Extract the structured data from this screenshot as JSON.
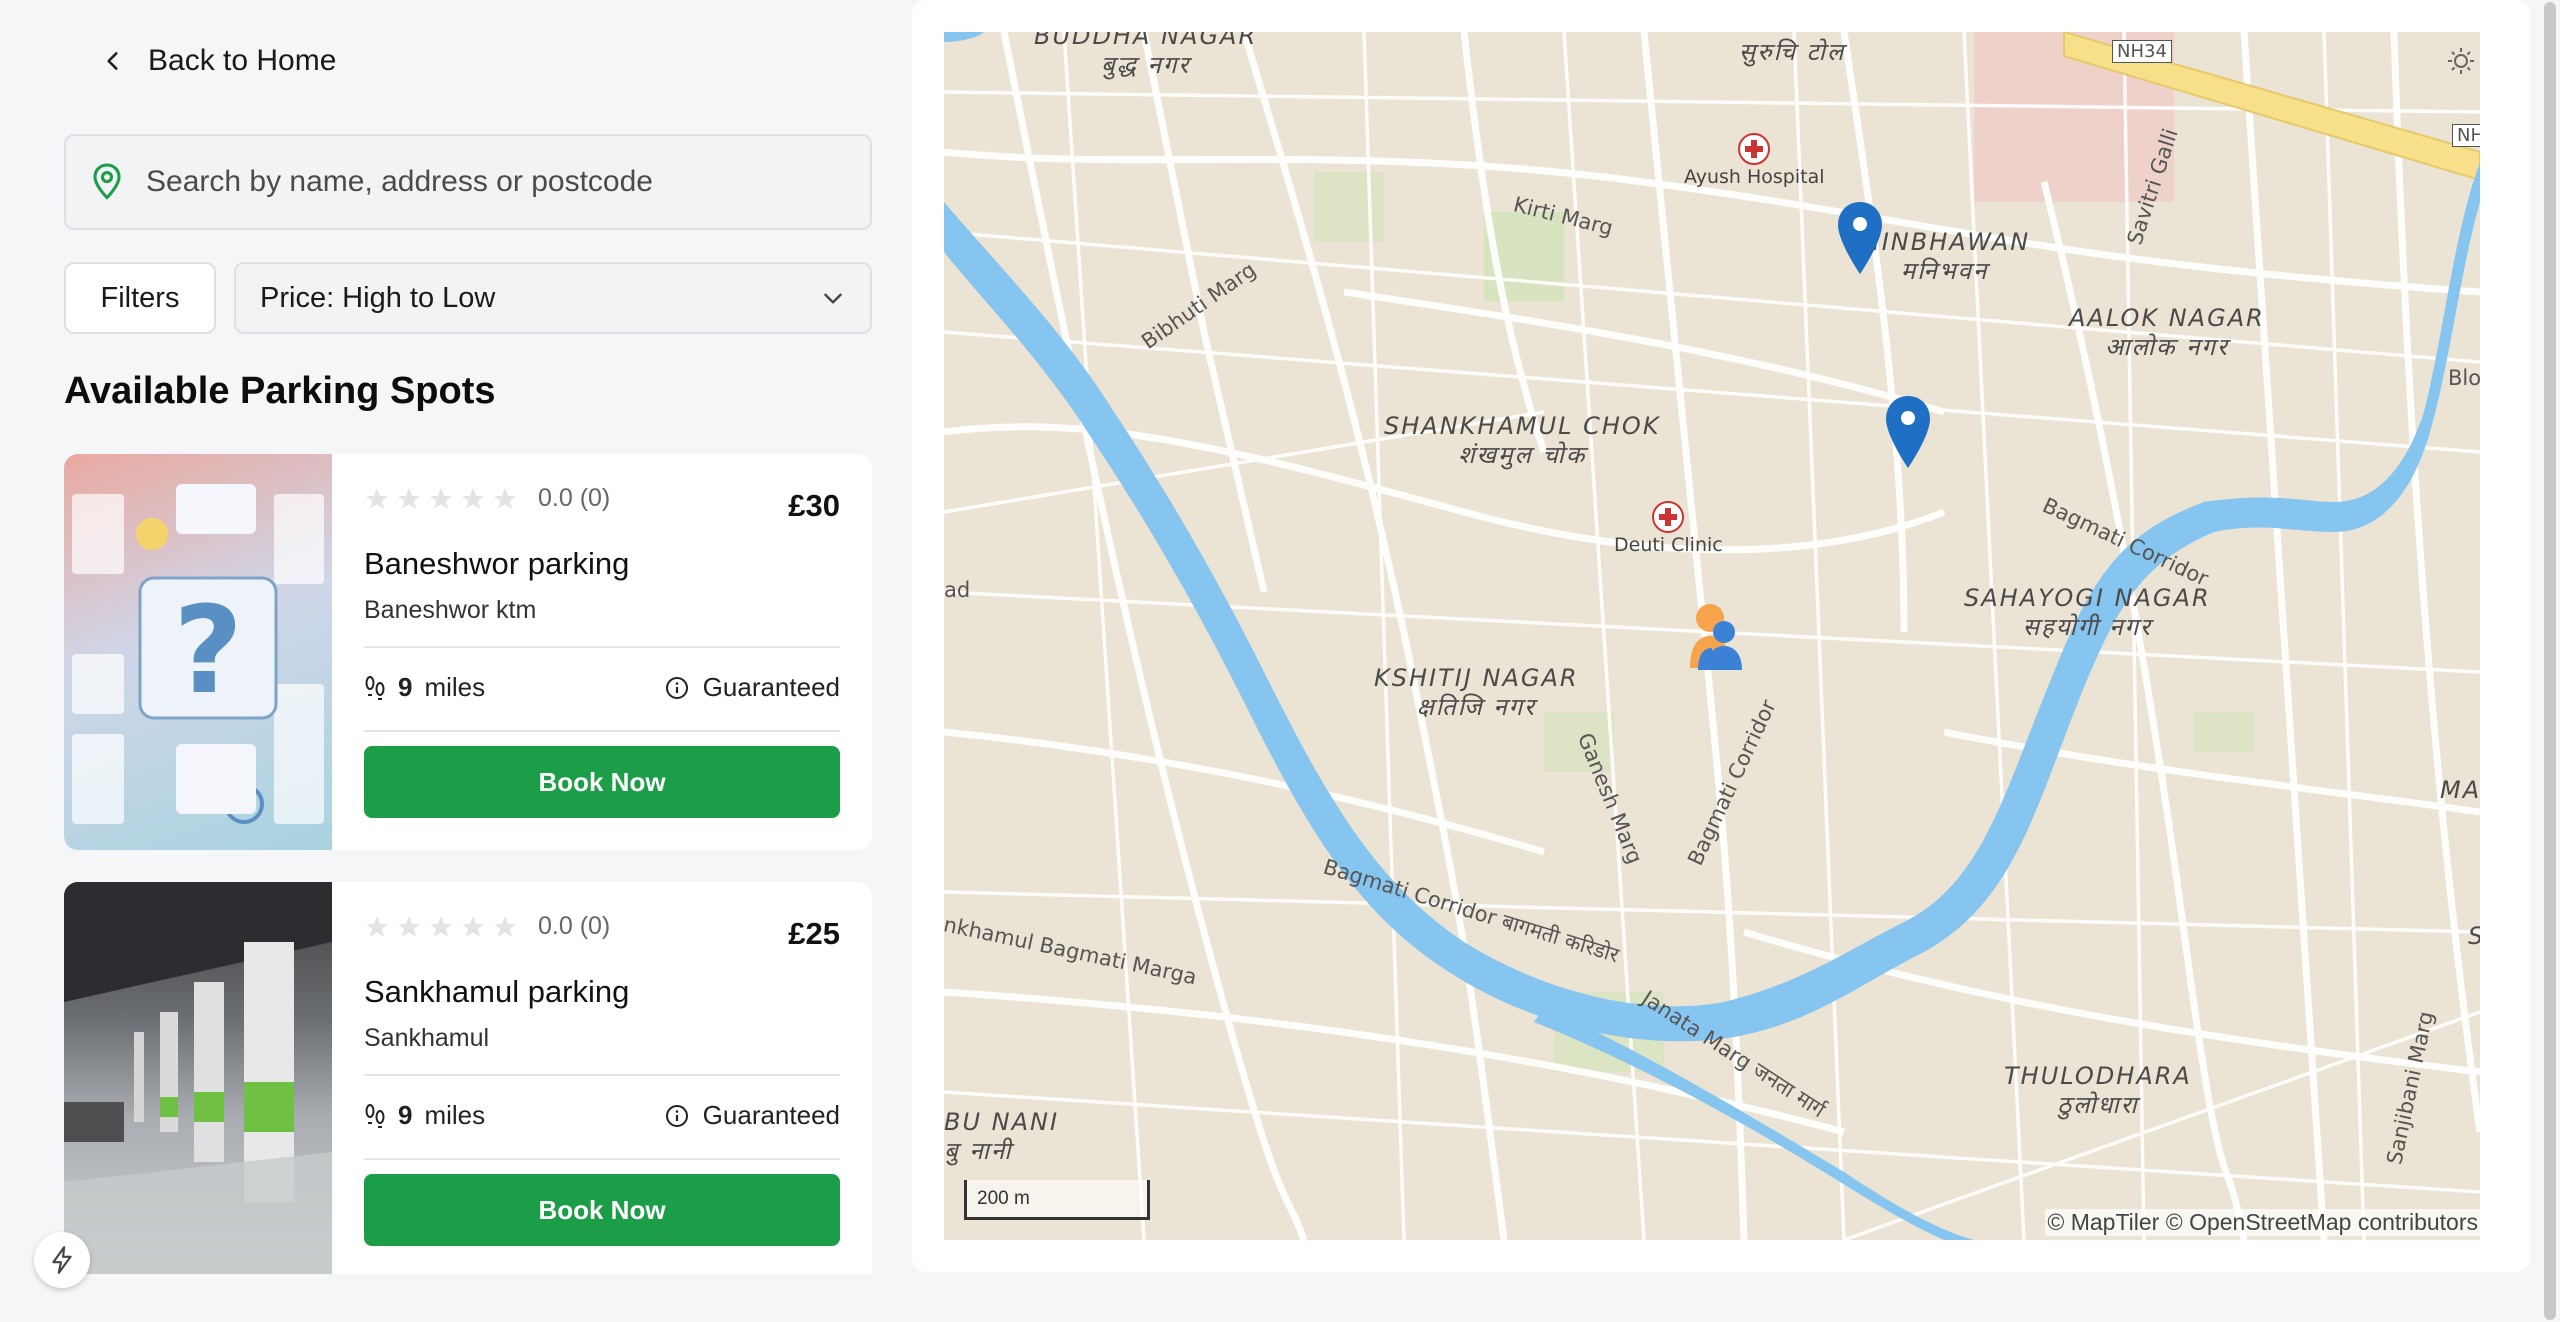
{
  "nav": {
    "back_label": "Back to Home"
  },
  "search": {
    "placeholder": "Search by name, address or postcode",
    "value": ""
  },
  "controls": {
    "filters_label": "Filters",
    "sort_value": "Price: High to Low"
  },
  "list": {
    "heading": "Available Parking Spots",
    "spots": [
      {
        "rating": "0.0 (0)",
        "price": "£30",
        "name": "Baneshwor parking",
        "address": "Baneshwor ktm",
        "distance_value": "9",
        "distance_unit": "miles",
        "guarantee": "Guaranteed",
        "book_label": "Book Now",
        "stars": 0
      },
      {
        "rating": "0.0 (0)",
        "price": "£25",
        "name": "Sankhamul parking",
        "address": "Sankhamul",
        "distance_value": "9",
        "distance_unit": "miles",
        "guarantee": "Guaranteed",
        "book_label": "Book Now",
        "stars": 0
      }
    ]
  },
  "map": {
    "areas": [
      {
        "en": "BUDDHA NAGAR",
        "np": "बुद्ध नगर"
      },
      {
        "en": "",
        "np": "सुरुचि टोल"
      },
      {
        "en": "MINBHAWAN",
        "np": "मनिभवन"
      },
      {
        "en": "AALOK NAGAR",
        "np": "आलोक नगर"
      },
      {
        "en": "SHANKHAMUL CHOK",
        "np": "शंखमुल चोक"
      },
      {
        "en": "SAHAYOGI NAGAR",
        "np": "सहयोगी नगर"
      },
      {
        "en": "KSHITIJ NAGAR",
        "np": "क्षतिजि नगर"
      },
      {
        "en": "THULODHARA",
        "np": "ठुलोधारा"
      },
      {
        "en": "BU NANI",
        "np": "बु नानी"
      }
    ],
    "pois": [
      "Ayush Hospital",
      "Deuti Clinic"
    ],
    "roads": [
      "Kirti Marg",
      "Bibhuti Marg",
      "Savitri Galli",
      "Bagmati Corridor",
      "Ganesh Marg",
      "Bagmati Corridor बागमती करिडोर",
      "Janata Marg जनता मार्ग",
      "Sanjibani Marg",
      "nkhamul Bagmati Marga",
      "NH34",
      "NH",
      "Bloo",
      "ad",
      "MA",
      "S"
    ],
    "scale_label": "200 m",
    "attribution": "© MapTiler © OpenStreetMap contributors",
    "colors": {
      "river": "#86c5f0",
      "land": "#ebe3d3",
      "road": "#ffffff",
      "highway": "#f8e08a",
      "pin": "#1f6fc4",
      "green": "#d7e4bf"
    }
  }
}
